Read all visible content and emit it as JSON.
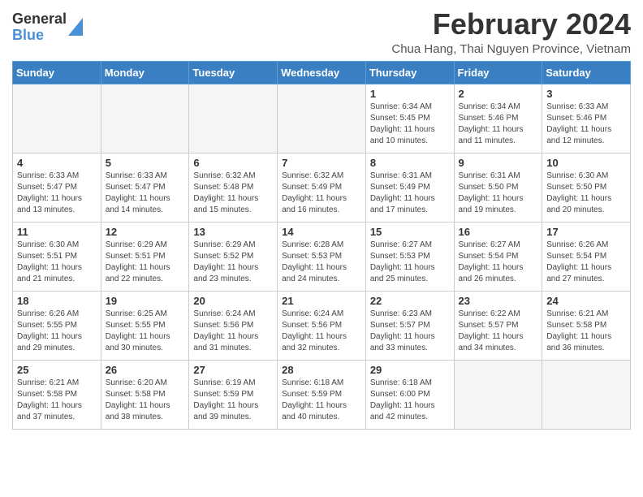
{
  "logo": {
    "general": "General",
    "blue": "Blue"
  },
  "title": "February 2024",
  "location": "Chua Hang, Thai Nguyen Province, Vietnam",
  "days_of_week": [
    "Sunday",
    "Monday",
    "Tuesday",
    "Wednesday",
    "Thursday",
    "Friday",
    "Saturday"
  ],
  "weeks": [
    [
      {
        "day": "",
        "info": "",
        "empty": true
      },
      {
        "day": "",
        "info": "",
        "empty": true
      },
      {
        "day": "",
        "info": "",
        "empty": true
      },
      {
        "day": "",
        "info": "",
        "empty": true
      },
      {
        "day": "1",
        "info": "Sunrise: 6:34 AM\nSunset: 5:45 PM\nDaylight: 11 hours\nand 10 minutes.",
        "empty": false
      },
      {
        "day": "2",
        "info": "Sunrise: 6:34 AM\nSunset: 5:46 PM\nDaylight: 11 hours\nand 11 minutes.",
        "empty": false
      },
      {
        "day": "3",
        "info": "Sunrise: 6:33 AM\nSunset: 5:46 PM\nDaylight: 11 hours\nand 12 minutes.",
        "empty": false
      }
    ],
    [
      {
        "day": "4",
        "info": "Sunrise: 6:33 AM\nSunset: 5:47 PM\nDaylight: 11 hours\nand 13 minutes.",
        "empty": false
      },
      {
        "day": "5",
        "info": "Sunrise: 6:33 AM\nSunset: 5:47 PM\nDaylight: 11 hours\nand 14 minutes.",
        "empty": false
      },
      {
        "day": "6",
        "info": "Sunrise: 6:32 AM\nSunset: 5:48 PM\nDaylight: 11 hours\nand 15 minutes.",
        "empty": false
      },
      {
        "day": "7",
        "info": "Sunrise: 6:32 AM\nSunset: 5:49 PM\nDaylight: 11 hours\nand 16 minutes.",
        "empty": false
      },
      {
        "day": "8",
        "info": "Sunrise: 6:31 AM\nSunset: 5:49 PM\nDaylight: 11 hours\nand 17 minutes.",
        "empty": false
      },
      {
        "day": "9",
        "info": "Sunrise: 6:31 AM\nSunset: 5:50 PM\nDaylight: 11 hours\nand 19 minutes.",
        "empty": false
      },
      {
        "day": "10",
        "info": "Sunrise: 6:30 AM\nSunset: 5:50 PM\nDaylight: 11 hours\nand 20 minutes.",
        "empty": false
      }
    ],
    [
      {
        "day": "11",
        "info": "Sunrise: 6:30 AM\nSunset: 5:51 PM\nDaylight: 11 hours\nand 21 minutes.",
        "empty": false
      },
      {
        "day": "12",
        "info": "Sunrise: 6:29 AM\nSunset: 5:51 PM\nDaylight: 11 hours\nand 22 minutes.",
        "empty": false
      },
      {
        "day": "13",
        "info": "Sunrise: 6:29 AM\nSunset: 5:52 PM\nDaylight: 11 hours\nand 23 minutes.",
        "empty": false
      },
      {
        "day": "14",
        "info": "Sunrise: 6:28 AM\nSunset: 5:53 PM\nDaylight: 11 hours\nand 24 minutes.",
        "empty": false
      },
      {
        "day": "15",
        "info": "Sunrise: 6:27 AM\nSunset: 5:53 PM\nDaylight: 11 hours\nand 25 minutes.",
        "empty": false
      },
      {
        "day": "16",
        "info": "Sunrise: 6:27 AM\nSunset: 5:54 PM\nDaylight: 11 hours\nand 26 minutes.",
        "empty": false
      },
      {
        "day": "17",
        "info": "Sunrise: 6:26 AM\nSunset: 5:54 PM\nDaylight: 11 hours\nand 27 minutes.",
        "empty": false
      }
    ],
    [
      {
        "day": "18",
        "info": "Sunrise: 6:26 AM\nSunset: 5:55 PM\nDaylight: 11 hours\nand 29 minutes.",
        "empty": false
      },
      {
        "day": "19",
        "info": "Sunrise: 6:25 AM\nSunset: 5:55 PM\nDaylight: 11 hours\nand 30 minutes.",
        "empty": false
      },
      {
        "day": "20",
        "info": "Sunrise: 6:24 AM\nSunset: 5:56 PM\nDaylight: 11 hours\nand 31 minutes.",
        "empty": false
      },
      {
        "day": "21",
        "info": "Sunrise: 6:24 AM\nSunset: 5:56 PM\nDaylight: 11 hours\nand 32 minutes.",
        "empty": false
      },
      {
        "day": "22",
        "info": "Sunrise: 6:23 AM\nSunset: 5:57 PM\nDaylight: 11 hours\nand 33 minutes.",
        "empty": false
      },
      {
        "day": "23",
        "info": "Sunrise: 6:22 AM\nSunset: 5:57 PM\nDaylight: 11 hours\nand 34 minutes.",
        "empty": false
      },
      {
        "day": "24",
        "info": "Sunrise: 6:21 AM\nSunset: 5:58 PM\nDaylight: 11 hours\nand 36 minutes.",
        "empty": false
      }
    ],
    [
      {
        "day": "25",
        "info": "Sunrise: 6:21 AM\nSunset: 5:58 PM\nDaylight: 11 hours\nand 37 minutes.",
        "empty": false
      },
      {
        "day": "26",
        "info": "Sunrise: 6:20 AM\nSunset: 5:58 PM\nDaylight: 11 hours\nand 38 minutes.",
        "empty": false
      },
      {
        "day": "27",
        "info": "Sunrise: 6:19 AM\nSunset: 5:59 PM\nDaylight: 11 hours\nand 39 minutes.",
        "empty": false
      },
      {
        "day": "28",
        "info": "Sunrise: 6:18 AM\nSunset: 5:59 PM\nDaylight: 11 hours\nand 40 minutes.",
        "empty": false
      },
      {
        "day": "29",
        "info": "Sunrise: 6:18 AM\nSunset: 6:00 PM\nDaylight: 11 hours\nand 42 minutes.",
        "empty": false
      },
      {
        "day": "",
        "info": "",
        "empty": true
      },
      {
        "day": "",
        "info": "",
        "empty": true
      }
    ]
  ]
}
